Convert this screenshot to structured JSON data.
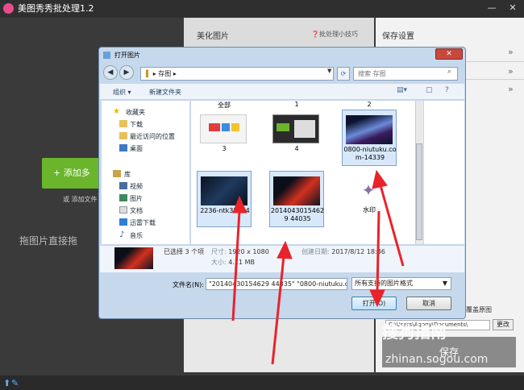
{
  "app": {
    "title": "美图秀秀批处理1.2",
    "minimize": "—",
    "close": "✕"
  },
  "left": {
    "add_button": "+ 添加多",
    "add_hint": "或 添加文件",
    "drag_hint": "拖图片直接拖"
  },
  "middle": {
    "title": "美化图片",
    "tips": "❓批处理小技巧"
  },
  "right": {
    "title": "保存设置",
    "save_cover": "覆盖原图",
    "save_path": "C:\\Users\\Agony\\Documents\\",
    "change_button": "更改",
    "save_button": "保存",
    "watermark_text": "搜狗指南",
    "watermark_url": "zhinan.sogou.com"
  },
  "dialog": {
    "title": "打开图片",
    "close": "✕",
    "address": "存图",
    "search_placeholder": "搜索 存图",
    "toolbar": {
      "organize": "组织",
      "new_folder": "新建文件夹"
    },
    "nav": [
      {
        "label": "收藏夹",
        "icon": "star-icon"
      },
      {
        "label": "下载",
        "icon": "folder-icon"
      },
      {
        "label": "最近访问的位置",
        "icon": "folder-icon"
      },
      {
        "label": "桌面",
        "icon": "desktop-icon"
      },
      {
        "label": "库",
        "icon": "library-icon"
      },
      {
        "label": "视频",
        "icon": "video-icon"
      },
      {
        "label": "图片",
        "icon": "image-icon"
      },
      {
        "label": "文档",
        "icon": "document-icon"
      },
      {
        "label": "迅雷下载",
        "icon": "download-icon"
      },
      {
        "label": "音乐",
        "icon": "music-icon"
      }
    ],
    "groups": [
      "全部",
      "1",
      "2"
    ],
    "tiles": [
      {
        "label": "3",
        "selected": false
      },
      {
        "label": "4",
        "selected": false
      },
      {
        "label": "0800-niutuku.com-14339",
        "selected": true
      },
      {
        "label": "2236-ntk35834",
        "selected": true
      },
      {
        "label": "20140430154629 44035",
        "selected": true
      },
      {
        "label": "水印",
        "selected": false
      }
    ],
    "info": {
      "selected": "已选择 3 个项",
      "size_key": "尺寸:",
      "size_val": "1920 x 1080",
      "filesize_key": "大小:",
      "filesize_val": "4.11 MB",
      "created_key": "创建日期:",
      "created_val": "2017/8/12 18:36"
    },
    "filename_label": "文件名(N):",
    "filename_value": "\"20140430154629 44035\" \"0800-niutuku.c",
    "filetype": "所有支持的图片格式",
    "open_button": "打开(O)",
    "cancel_button": "取消"
  }
}
